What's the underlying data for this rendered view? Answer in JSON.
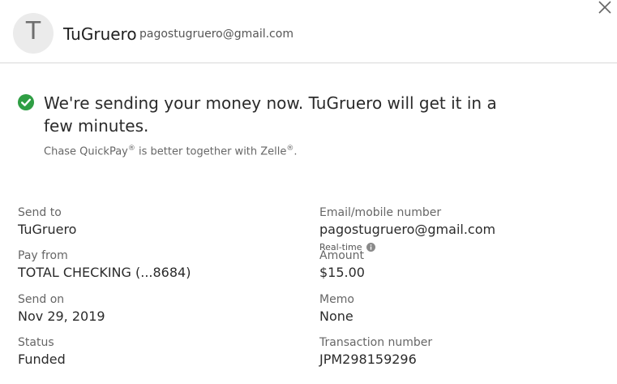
{
  "header": {
    "avatar_initial": "T",
    "recipient_name": "TuGruero",
    "recipient_email": "pagostugruero@gmail.com",
    "close_icon": "close-icon"
  },
  "confirmation": {
    "message": "We're sending your money now. TuGruero will get it in a few minutes.",
    "tagline_a": "Chase QuickPay",
    "tagline_b": " is better together with Zelle",
    "tagline_end": ".",
    "registered_mark": "®",
    "status_color": "#2f9e44"
  },
  "details": {
    "send_to_label": "Send to",
    "send_to_value": "TuGruero",
    "email_label": "Email/mobile number",
    "email_value": "pagostugruero@gmail.com",
    "pay_from_label": "Pay from",
    "pay_from_value": "TOTAL CHECKING (...8684)",
    "realtime_label": "Real-time",
    "amount_label": "Amount",
    "amount_value": "$15.00",
    "send_on_label": "Send on",
    "send_on_value": "Nov 29, 2019",
    "memo_label": "Memo",
    "memo_value": "None",
    "status_label": "Status",
    "status_value": "Funded",
    "transaction_label": "Transaction number",
    "transaction_value": "JPM298159296"
  }
}
